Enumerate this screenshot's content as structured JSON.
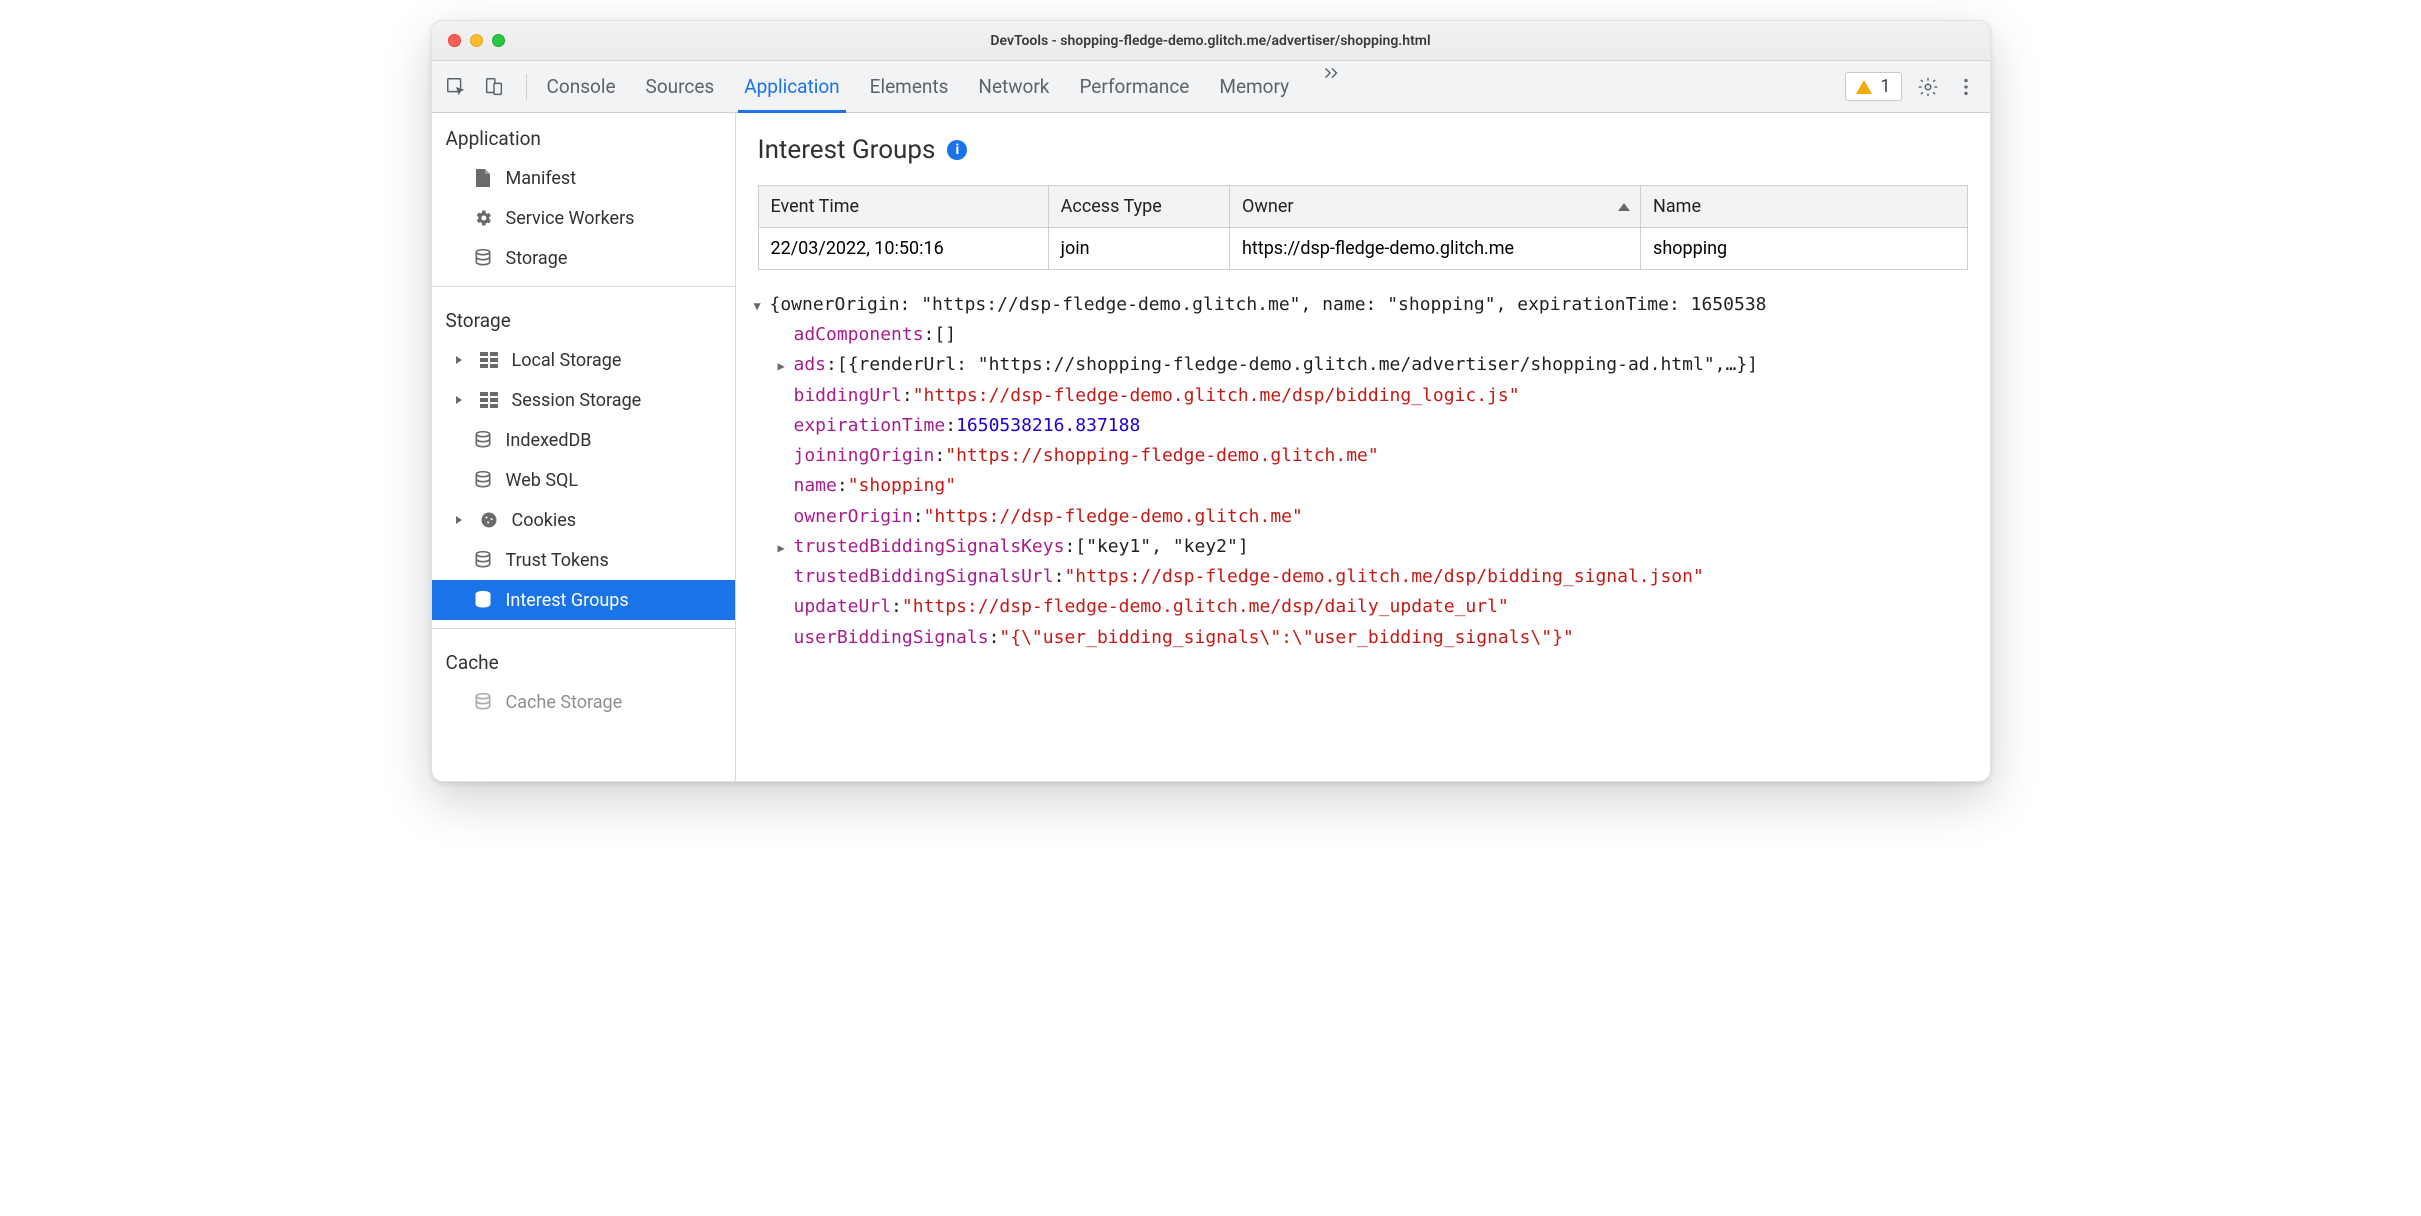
{
  "window": {
    "title": "DevTools - shopping-fledge-demo.glitch.me/advertiser/shopping.html"
  },
  "toolbar": {
    "tabs": [
      "Console",
      "Sources",
      "Application",
      "Elements",
      "Network",
      "Performance",
      "Memory"
    ],
    "active_tab": "Application",
    "warning_count": "1"
  },
  "sidebar": {
    "groups": [
      {
        "title": "Application",
        "items": [
          {
            "label": "Manifest",
            "icon": "file"
          },
          {
            "label": "Service Workers",
            "icon": "gear"
          },
          {
            "label": "Storage",
            "icon": "db"
          }
        ]
      },
      {
        "title": "Storage",
        "items": [
          {
            "label": "Local Storage",
            "icon": "grid",
            "caret": true
          },
          {
            "label": "Session Storage",
            "icon": "grid",
            "caret": true
          },
          {
            "label": "IndexedDB",
            "icon": "db"
          },
          {
            "label": "Web SQL",
            "icon": "db"
          },
          {
            "label": "Cookies",
            "icon": "cookie",
            "caret": true
          },
          {
            "label": "Trust Tokens",
            "icon": "db"
          },
          {
            "label": "Interest Groups",
            "icon": "db",
            "selected": true
          }
        ]
      },
      {
        "title": "Cache",
        "items": [
          {
            "label": "Cache Storage",
            "icon": "db"
          }
        ]
      }
    ]
  },
  "pane": {
    "heading": "Interest Groups",
    "columns": [
      "Event Time",
      "Access Type",
      "Owner",
      "Name"
    ],
    "sort_col": 2,
    "rows": [
      {
        "event_time": "22/03/2022, 10:50:16",
        "access_type": "join",
        "owner": "https://dsp-fledge-demo.glitch.me",
        "name": "shopping"
      }
    ],
    "object": {
      "root_line": "{ownerOrigin: \"https://dsp-fledge-demo.glitch.me\", name: \"shopping\", expirationTime: 1650538",
      "adComponents": "[]",
      "ads_line": "[{renderUrl: \"https://shopping-fledge-demo.glitch.me/advertiser/shopping-ad.html\",…}]",
      "biddingUrl": "\"https://dsp-fledge-demo.glitch.me/dsp/bidding_logic.js\"",
      "expirationTime": "1650538216.837188",
      "joiningOrigin": "\"https://shopping-fledge-demo.glitch.me\"",
      "name": "\"shopping\"",
      "ownerOrigin": "\"https://dsp-fledge-demo.glitch.me\"",
      "trustedBiddingSignalsKeys": "[\"key1\", \"key2\"]",
      "trustedBiddingSignalsUrl": "\"https://dsp-fledge-demo.glitch.me/dsp/bidding_signal.json\"",
      "updateUrl": "\"https://dsp-fledge-demo.glitch.me/dsp/daily_update_url\"",
      "userBiddingSignals": "\"{\\\"user_bidding_signals\\\":\\\"user_bidding_signals\\\"}\""
    }
  }
}
